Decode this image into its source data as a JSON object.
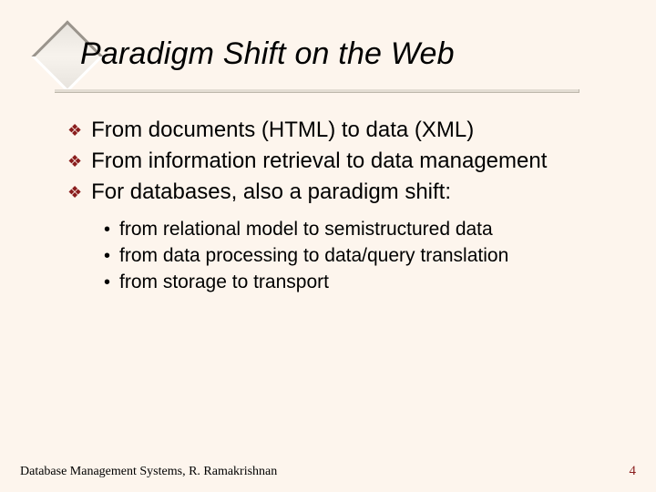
{
  "title": "Paradigm Shift on the Web",
  "bullets_l1": [
    "From documents (HTML) to data (XML)",
    "From information retrieval to data management",
    "For databases, also a paradigm shift:"
  ],
  "bullets_l2": [
    "from relational model to semistructured data",
    "from data processing to data/query translation",
    "from storage to transport"
  ],
  "footer": {
    "left": "Database Management Systems, R. Ramakrishnan",
    "page": "4"
  },
  "glyphs": {
    "diamond_bullet": "❖",
    "dot_bullet": "•"
  }
}
